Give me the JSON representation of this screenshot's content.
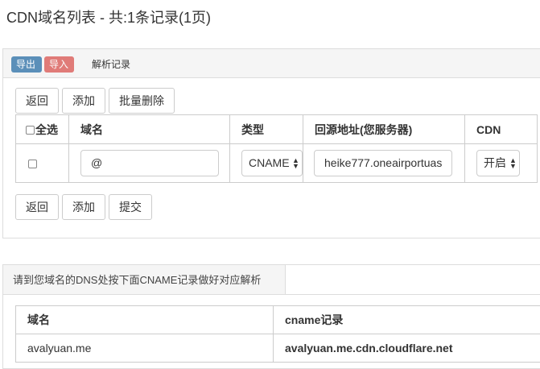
{
  "page": {
    "title": "CDN域名列表 - 共:1条记录(1页)"
  },
  "toolbar": {
    "export_label": "导出",
    "import_label": "导入",
    "tab_label": "解析记录"
  },
  "actions_top": {
    "back_label": "返回",
    "add_label": "添加",
    "batch_delete_label": "批量删除"
  },
  "record_table": {
    "headers": {
      "select_all": "全选",
      "domain": "域名",
      "type": "类型",
      "origin": "回源地址(您服务器)",
      "cdn": "CDN"
    },
    "rows": [
      {
        "domain": "@",
        "type": "CNAME",
        "origin": "heike777.oneairportuas",
        "cdn": "开启"
      }
    ]
  },
  "actions_bottom": {
    "back_label": "返回",
    "add_label": "添加",
    "submit_label": "提交"
  },
  "cname_panel": {
    "title": "请到您域名的DNS处按下面CNAME记录做好对应解析",
    "headers": {
      "domain": "域名",
      "cname": "cname记录"
    },
    "rows": [
      {
        "domain": "avalyuan.me",
        "cname": "avalyuan.me.cdn.cloudflare.net"
      }
    ]
  },
  "colors": {
    "export_button": "#5b8fb9",
    "import_button": "#d9534f",
    "panel_header": "#f5f5f5",
    "border": "#cccccc"
  }
}
